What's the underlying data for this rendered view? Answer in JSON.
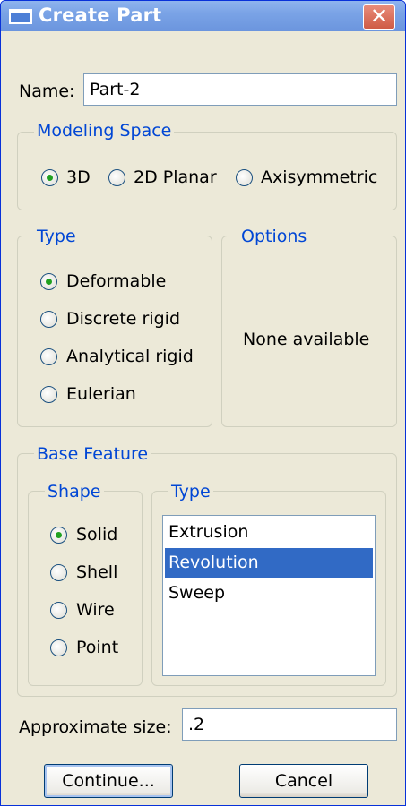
{
  "window": {
    "title": "Create Part",
    "icon": "window-icon",
    "close_icon": "close-icon"
  },
  "name": {
    "label": "Name:",
    "value": "Part-2"
  },
  "modeling_space": {
    "legend": "Modeling Space",
    "options": [
      {
        "label": "3D",
        "checked": true
      },
      {
        "label": "2D Planar",
        "checked": false
      },
      {
        "label": "Axisymmetric",
        "checked": false
      }
    ]
  },
  "type": {
    "legend": "Type",
    "options": [
      {
        "label": "Deformable",
        "checked": true
      },
      {
        "label": "Discrete rigid",
        "checked": false
      },
      {
        "label": "Analytical rigid",
        "checked": false
      },
      {
        "label": "Eulerian",
        "checked": false
      }
    ]
  },
  "options": {
    "legend": "Options",
    "message": "None available"
  },
  "base_feature": {
    "legend": "Base Feature",
    "shape": {
      "legend": "Shape",
      "options": [
        {
          "label": "Solid",
          "checked": true
        },
        {
          "label": "Shell",
          "checked": false
        },
        {
          "label": "Wire",
          "checked": false
        },
        {
          "label": "Point",
          "checked": false
        }
      ]
    },
    "type": {
      "legend": "Type",
      "items": [
        "Extrusion",
        "Revolution",
        "Sweep"
      ],
      "selected": "Revolution"
    }
  },
  "approximate_size": {
    "label": "Approximate size:",
    "value": ".2"
  },
  "buttons": {
    "continue": "Continue...",
    "cancel": "Cancel"
  },
  "colors": {
    "accent_legend": "#0046d5",
    "selection": "#316ac5",
    "radio_checked": "#21a121"
  }
}
